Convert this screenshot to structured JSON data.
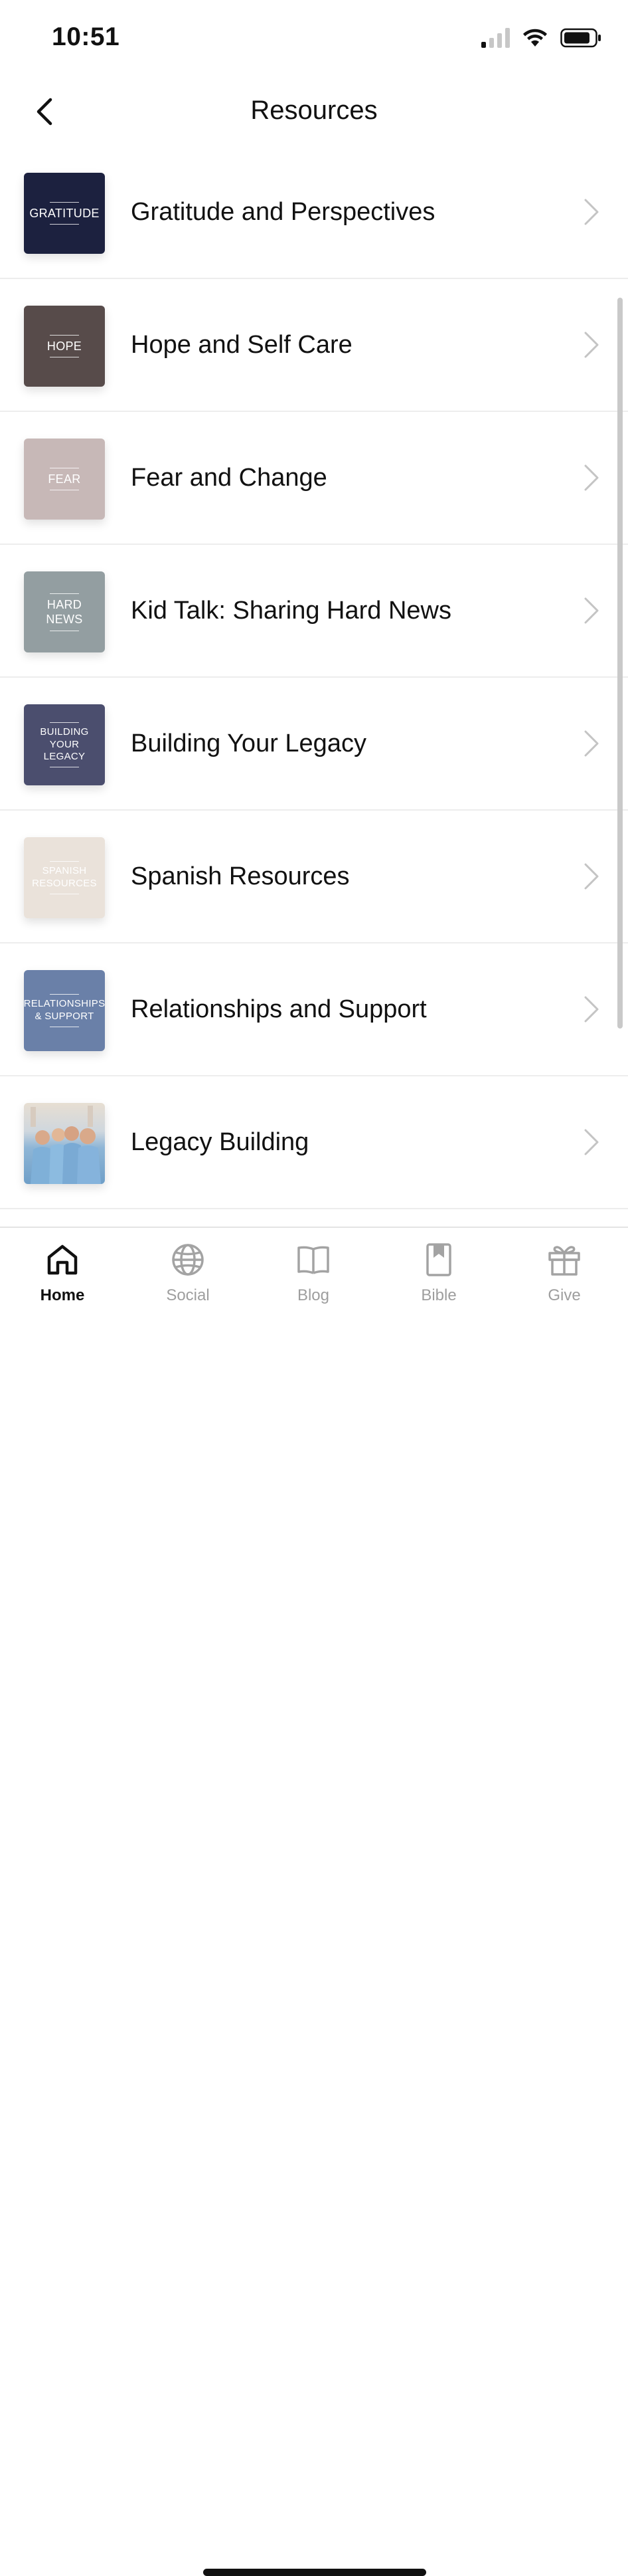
{
  "status": {
    "time": "10:51"
  },
  "nav": {
    "title": "Resources"
  },
  "items": [
    {
      "label": "Gratitude and Perspectives",
      "thumb_text": "GRATITUDE",
      "thumb_color": "#1c213f"
    },
    {
      "label": "Hope and Self Care",
      "thumb_text": "HOPE",
      "thumb_color": "#574b4a"
    },
    {
      "label": "Fear and Change",
      "thumb_text": "FEAR",
      "thumb_color": "#c7b8b7"
    },
    {
      "label": "Kid Talk: Sharing Hard News",
      "thumb_text": "HARD NEWS",
      "thumb_color": "#939ea1"
    },
    {
      "label": "Building Your Legacy",
      "thumb_text_1": "BUILDING",
      "thumb_text_2": "YOUR LEGACY",
      "thumb_color": "#4b4e6e"
    },
    {
      "label": "Spanish Resources",
      "thumb_text_1": "SPANISH",
      "thumb_text_2": "RESOURCES",
      "thumb_color": "#eae2da"
    },
    {
      "label": "Relationships and Support",
      "thumb_text_1": "RELATIONSHIPS",
      "thumb_text_2": "& SUPPORT",
      "thumb_color": "#6a80a8"
    },
    {
      "label": "Legacy Building",
      "thumb_color": "#8fb6d6"
    }
  ],
  "tabs": [
    {
      "label": "Home",
      "icon": "home-icon",
      "active": true
    },
    {
      "label": "Social",
      "icon": "globe-icon"
    },
    {
      "label": "Blog",
      "icon": "book-open-icon"
    },
    {
      "label": "Bible",
      "icon": "bookmark-book-icon"
    },
    {
      "label": "Give",
      "icon": "gift-icon"
    }
  ]
}
